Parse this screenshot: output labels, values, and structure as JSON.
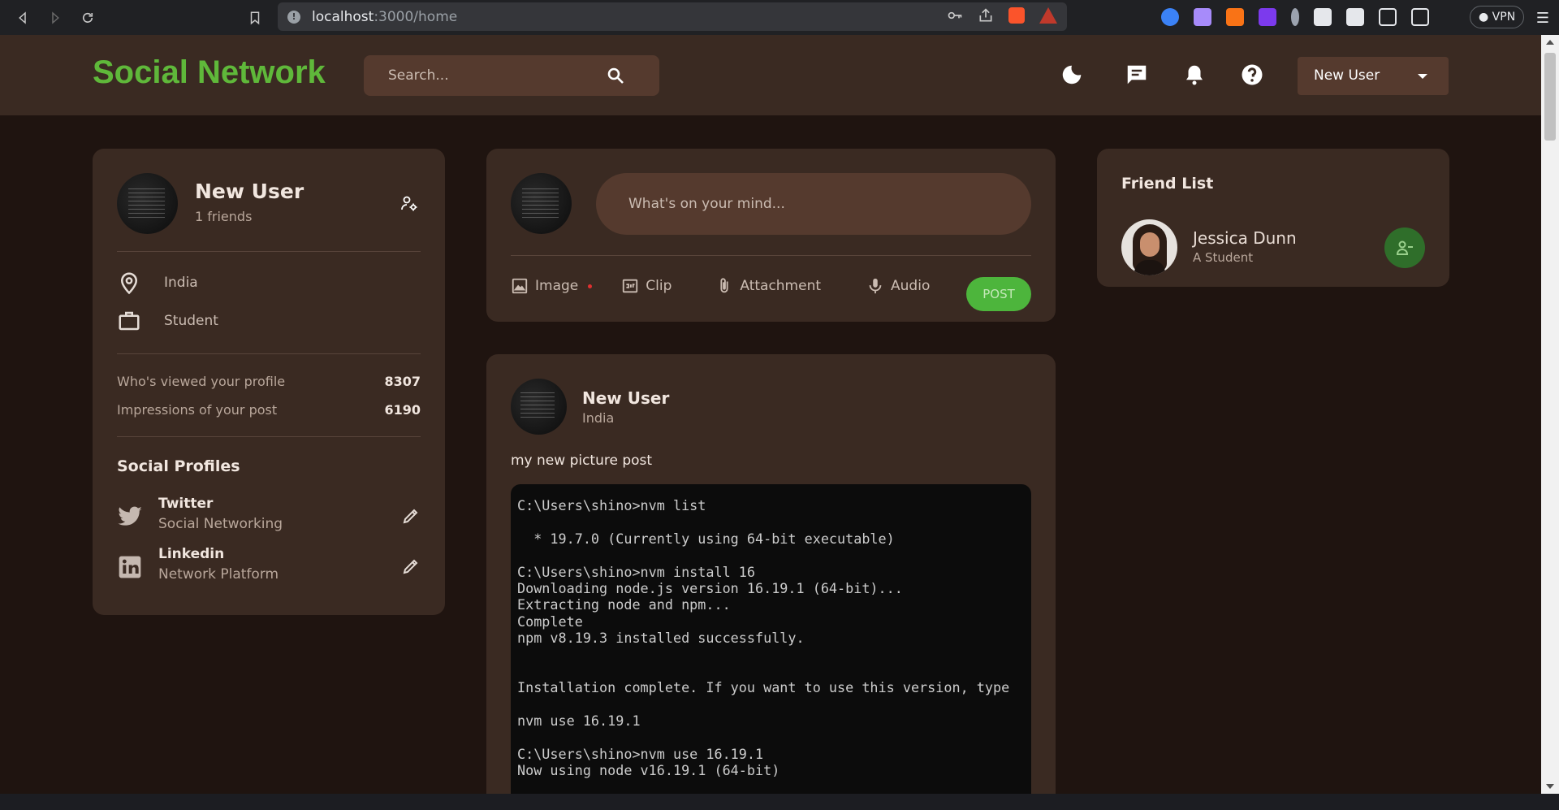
{
  "browser": {
    "url_host": "localhost",
    "url_path": ":3000/home",
    "vpn_label": "VPN"
  },
  "navbar": {
    "logo": "Social Network",
    "search_placeholder": "Search...",
    "user_select": "New User"
  },
  "profile": {
    "name": "New User",
    "friends": "1 friends",
    "location": "India",
    "occupation": "Student",
    "stats": [
      {
        "label": "Who's viewed your profile",
        "value": "8307"
      },
      {
        "label": "Impressions of your post",
        "value": "6190"
      }
    ],
    "social_title": "Social Profiles",
    "socials": [
      {
        "name": "Twitter",
        "sub": "Social Networking"
      },
      {
        "name": "Linkedin",
        "sub": "Network Platform"
      }
    ]
  },
  "composer": {
    "placeholder": "What's on your mind...",
    "tools": [
      "Image",
      "Clip",
      "Attachment",
      "Audio"
    ],
    "post_label": "POST"
  },
  "post": {
    "author": "New User",
    "location": "India",
    "text": "my new picture post",
    "terminal_lines": [
      "C:\\Users\\shino>nvm list",
      "",
      "  * 19.7.0 (Currently using 64-bit executable)",
      "",
      "C:\\Users\\shino>nvm install 16",
      "Downloading node.js version 16.19.1 (64-bit)...",
      "Extracting node and npm...",
      "Complete",
      "npm v8.19.3 installed successfully.",
      "",
      "",
      "Installation complete. If you want to use this version, type",
      "",
      "nvm use 16.19.1",
      "",
      "C:\\Users\\shino>nvm use 16.19.1",
      "Now using node v16.19.1 (64-bit)"
    ]
  },
  "friend_list": {
    "title": "Friend List",
    "friends": [
      {
        "name": "Jessica Dunn",
        "sub": "A Student"
      }
    ]
  },
  "colors": {
    "accent_green": "#5fb83a",
    "card_bg": "#3a2a22",
    "page_bg": "#1f1410"
  }
}
